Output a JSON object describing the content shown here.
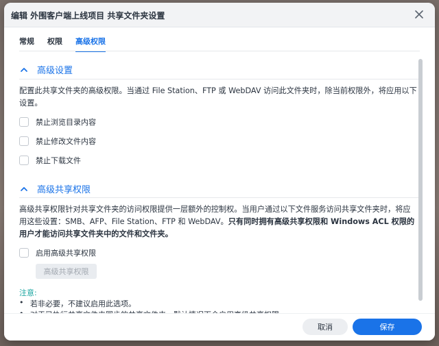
{
  "window": {
    "title": "编辑 外围客户端上线项目 共享文件夹设置"
  },
  "tabs": [
    {
      "label": "常规"
    },
    {
      "label": "权限"
    },
    {
      "label": "高级权限"
    }
  ],
  "advanced_settings": {
    "header": "高级设置",
    "description": "配置此共享文件夹的高级权限。当通过 File Station、FTP 或 WebDAV 访问此文件夹时，除当前权限外，将应用以下设置。",
    "options": [
      {
        "label": "禁止浏览目录内容",
        "checked": false
      },
      {
        "label": "禁止修改文件内容",
        "checked": false
      },
      {
        "label": "禁止下载文件",
        "checked": false
      }
    ]
  },
  "advanced_share": {
    "header": "高级共享权限",
    "description_normal": "高级共享权限针对共享文件夹的访问权限提供一层额外的控制权。当用户通过以下文件服务访问共享文件夹时，将应用这些设置：SMB、AFP、File Station、FTP 和 WebDAV。",
    "description_bold": "只有同时拥有高级共享权限和 Windows ACL 权限的用户才能访问共享文件夹中的文件和文件夹。",
    "enable_label": "启用高级共享权限",
    "enable_checked": false,
    "button_label": "高级共享权限"
  },
  "notes": {
    "title": "注意:",
    "items": [
      "若非必要，不建议启用此选项。",
      "对于已执行共享文件夹同步的共享文件夹，默认情况下会启用高级共享权限。"
    ]
  },
  "footer": {
    "cancel_label": "取消",
    "save_label": "保存"
  },
  "colors": {
    "accent": "#1a73e8",
    "note": "#1aa5a0"
  }
}
